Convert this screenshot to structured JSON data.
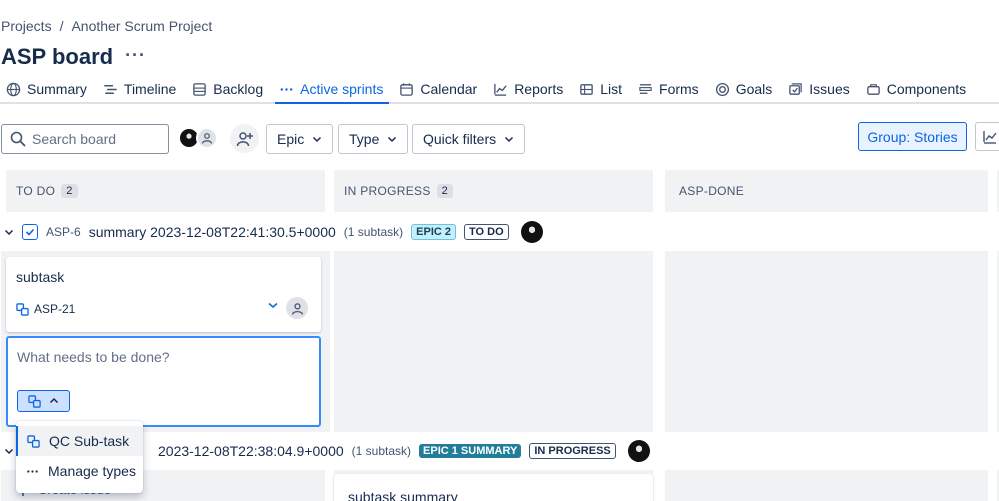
{
  "breadcrumb": {
    "projects": "Projects",
    "separator": "/",
    "project": "Another Scrum Project"
  },
  "header": {
    "title": "ASP board",
    "more": "···"
  },
  "tabs": [
    {
      "label": "Summary",
      "icon": "globe-icon"
    },
    {
      "label": "Timeline",
      "icon": "timeline-icon"
    },
    {
      "label": "Backlog",
      "icon": "backlog-icon"
    },
    {
      "label": "Active sprints",
      "icon": "dots-icon",
      "active": true
    },
    {
      "label": "Calendar",
      "icon": "calendar-icon"
    },
    {
      "label": "Reports",
      "icon": "chart-line-icon"
    },
    {
      "label": "List",
      "icon": "list-icon"
    },
    {
      "label": "Forms",
      "icon": "forms-icon"
    },
    {
      "label": "Goals",
      "icon": "target-icon"
    },
    {
      "label": "Issues",
      "icon": "issues-icon"
    },
    {
      "label": "Components",
      "icon": "components-icon"
    }
  ],
  "toolbar": {
    "search_placeholder": "Search board",
    "epic": "Epic",
    "type": "Type",
    "quick_filters": "Quick filters",
    "group": "Group: Stories"
  },
  "columns": [
    {
      "name": "TO DO",
      "count": "2"
    },
    {
      "name": "IN PROGRESS",
      "count": "2"
    },
    {
      "name": "ASP-DONE",
      "count": ""
    }
  ],
  "lane1": {
    "key": "ASP-6",
    "summary": "summary 2023-12-08T22:41:30.5+0000",
    "subtasks": "(1 subtask)",
    "epic": "EPIC 2",
    "status": "TO DO"
  },
  "card": {
    "title": "subtask",
    "key": "ASP-21"
  },
  "create": {
    "placeholder": "What needs to be done?"
  },
  "menu": {
    "item1": "QC Sub-task",
    "item2": "Manage types"
  },
  "lane2": {
    "summary_visible": "2023-12-08T22:38:04.9+0000",
    "subtasks": "(1 subtask)",
    "epic": "EPIC 1 SUMMARY",
    "status": "IN PROGRESS"
  },
  "card2": {
    "title": "subtask summary"
  },
  "create_issue": "Create issue",
  "colors": {
    "accent": "#0c66e4",
    "column_bg": "#f1f2f4",
    "epic1": "#227d9b",
    "epic2": "#c6edfb"
  }
}
